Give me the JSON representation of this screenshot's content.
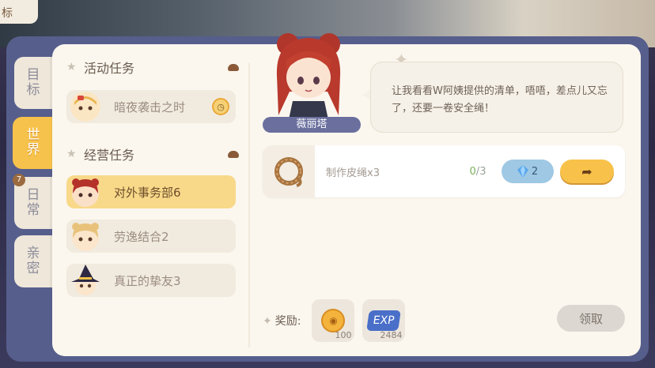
{
  "background": {
    "corner_text": "标"
  },
  "side_tabs": [
    {
      "label": "目标",
      "active": false
    },
    {
      "label": "世界",
      "active": true
    },
    {
      "label": "日常",
      "active": false,
      "badge": "7"
    },
    {
      "label": "亲密",
      "active": false
    }
  ],
  "sections": [
    {
      "title": "活动任务",
      "tasks": [
        {
          "label": "暗夜袭击之时",
          "has_clock": true
        }
      ]
    },
    {
      "title": "经营任务",
      "tasks": [
        {
          "label": "对外事务部6",
          "active": true
        },
        {
          "label": "劳逸结合2"
        },
        {
          "label": "真正的挚友3"
        }
      ]
    }
  ],
  "npc": {
    "name": "薇丽塔",
    "dialogue": "让我看看W阿姨提供的清单，唔唔，差点儿又忘了，还要一卷安全绳！"
  },
  "objective": {
    "label": "制作皮绳x3",
    "progress_done": "0",
    "progress_total": "3",
    "progress_sep": "/",
    "gem_cost": "2",
    "icon": "rope-coil-icon"
  },
  "reward": {
    "label": "奖励:",
    "items": [
      {
        "icon": "coin-icon",
        "count": "100"
      },
      {
        "icon": "exp-icon",
        "text": "EXP",
        "count": "2484"
      }
    ]
  },
  "claim_label": "领取",
  "colors": {
    "accent": "#f7c24b",
    "frame": "#565e8c",
    "panel": "#fbf7ef"
  }
}
